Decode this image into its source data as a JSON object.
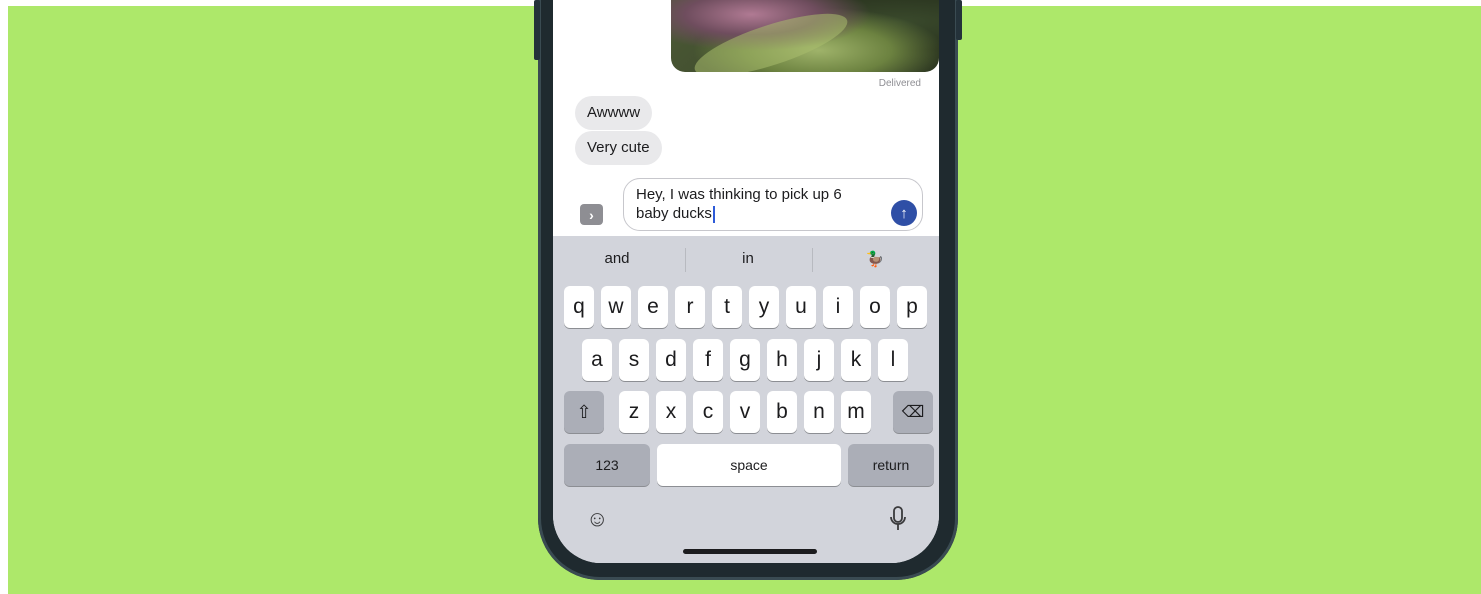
{
  "colors": {
    "background": "#ade86a",
    "bubble": "#e9e9eb",
    "send_button": "#2f4fa6",
    "keyboard": "#d2d4db"
  },
  "conversation": {
    "delivered_label": "Delivered",
    "messages": [
      {
        "text": "Awwww"
      },
      {
        "text": "Very cute"
      }
    ]
  },
  "composer": {
    "expand_icon": "chevron-right-icon",
    "text_line1": "Hey, I was thinking to pick up 6",
    "text_line2": "baby ducks",
    "send_icon": "arrow-up-icon"
  },
  "keyboard": {
    "suggestions": [
      "and",
      "in",
      "🦆"
    ],
    "row1": [
      "q",
      "w",
      "e",
      "r",
      "t",
      "y",
      "u",
      "i",
      "o",
      "p"
    ],
    "row2": [
      "a",
      "s",
      "d",
      "f",
      "g",
      "h",
      "j",
      "k",
      "l"
    ],
    "row3": [
      "z",
      "x",
      "c",
      "v",
      "b",
      "n",
      "m"
    ],
    "shift_icon": "shift-icon",
    "delete_icon": "backspace-icon",
    "numbers_label": "123",
    "space_label": "space",
    "return_label": "return",
    "emoji_icon": "emoji-icon",
    "mic_icon": "microphone-icon"
  }
}
